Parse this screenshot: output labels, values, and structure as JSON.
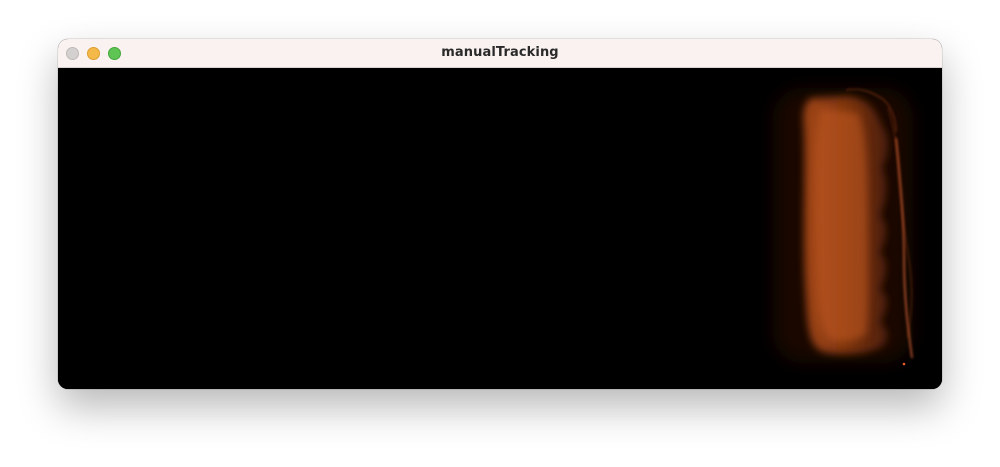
{
  "window": {
    "title": "manualTracking",
    "controls": {
      "close": "close-button",
      "minimize": "minimize-button",
      "zoom": "zoom-button"
    }
  },
  "colors": {
    "titlebar": "#f9f2f0",
    "viewport_background": "#000000",
    "glow": "#c8561c",
    "filament": "#e05a2a",
    "close": "#d3d0cf",
    "minimize": "#f5b94a",
    "zoom": "#5ec453"
  }
}
